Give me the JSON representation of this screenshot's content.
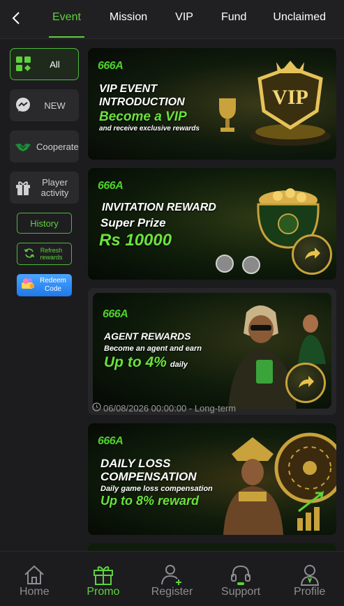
{
  "tabs": [
    "Event",
    "Mission",
    "VIP",
    "Fund",
    "Unclaimed"
  ],
  "sidebar": {
    "categories": [
      {
        "label": "All",
        "icon": "grid-icon"
      },
      {
        "label": "NEW",
        "icon": "chat-bubble-icon"
      },
      {
        "label": "Cooperate",
        "icon": "handshake-icon"
      },
      {
        "label": "Player activity",
        "icon": "gift-icon"
      }
    ],
    "history_label": "History",
    "refresh_label": "Refresh rewards",
    "redeem_label": "Redeem Code"
  },
  "banners": [
    {
      "brand": "666A",
      "line1": "VIP EVENT",
      "line2": "INTRODUCTION",
      "line3": "Become a VIP",
      "line4": "and receive exclusive rewards",
      "badge": "VIP"
    },
    {
      "brand": "666A",
      "line1": "INVITATION REWARD",
      "line2": "Super Prize",
      "line3": "Rs 10000"
    },
    {
      "brand": "666A",
      "line1": "AGENT REWARDS",
      "line2": "Become an agent and earn",
      "line3": "Up to 4%",
      "line3b": "daily",
      "time": "06/08/2026 00:00:00 - Long-term"
    },
    {
      "brand": "666A",
      "line1": "DAILY LOSS",
      "line2": "COMPENSATION",
      "line3": "Daily game loss compensation",
      "line4": "Up to 8% reward"
    }
  ],
  "bottom_nav": [
    {
      "label": "Home",
      "icon": "home-icon"
    },
    {
      "label": "Promo",
      "icon": "gift-box-icon"
    },
    {
      "label": "Register",
      "icon": "add-user-icon"
    },
    {
      "label": "Support",
      "icon": "headset-icon"
    },
    {
      "label": "Profile",
      "icon": "profile-icon"
    }
  ],
  "colors": {
    "accent": "#5fd13c",
    "background": "#1c1c1e",
    "panel": "#2a2a2d",
    "redeem": "#2f86f5"
  }
}
